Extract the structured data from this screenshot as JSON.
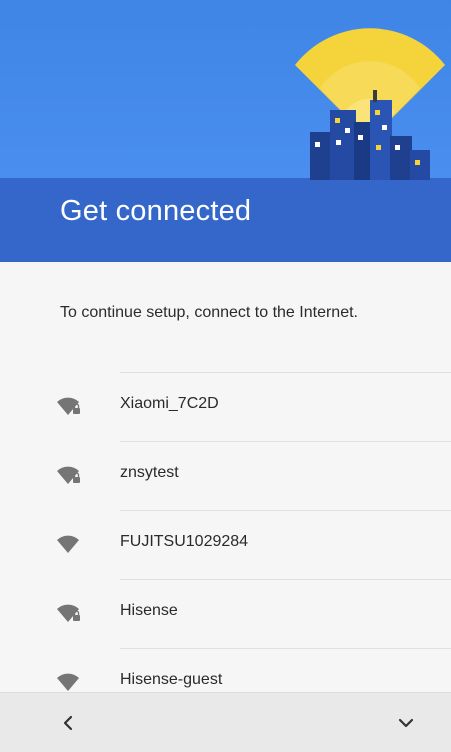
{
  "header": {
    "title": "Get connected"
  },
  "prompt": "To continue setup, connect to the Internet.",
  "networks": [
    {
      "ssid": "Xiaomi_7C2D",
      "secured": true,
      "icon": "wifi-lock-icon"
    },
    {
      "ssid": "znsytest",
      "secured": true,
      "icon": "wifi-lock-icon"
    },
    {
      "ssid": "FUJITSU1029284",
      "secured": false,
      "icon": "wifi-icon"
    },
    {
      "ssid": "Hisense",
      "secured": true,
      "icon": "wifi-lock-icon"
    },
    {
      "ssid": "Hisense-guest",
      "secured": false,
      "icon": "wifi-icon"
    }
  ],
  "navigation": {
    "back_icon": "chevron-left-icon",
    "more_icon": "chevron-down-icon"
  },
  "colors": {
    "header_blue": "#3f85e6",
    "band_blue": "#3467c9",
    "signal_yellow": "#f5d33b",
    "icon_gray": "#757575"
  }
}
